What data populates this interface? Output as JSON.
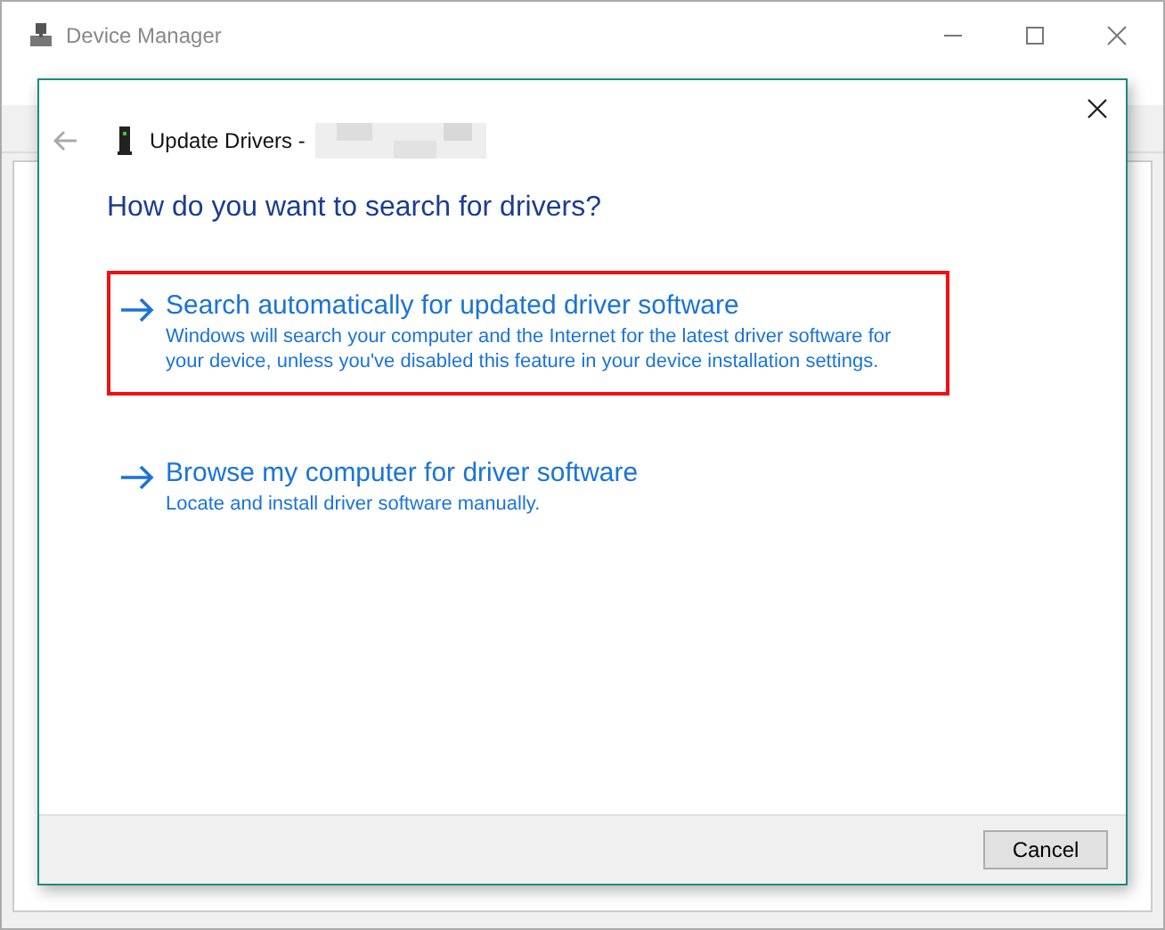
{
  "window": {
    "title": "Device Manager"
  },
  "dialog": {
    "title": "Update Drivers -",
    "heading": "How do you want to search for drivers?",
    "options": [
      {
        "title": "Search automatically for updated driver software",
        "description": "Windows will search your computer and the Internet for the latest driver software for your device, unless you've disabled this feature in your device installation settings.",
        "selected": true
      },
      {
        "title": "Browse my computer for driver software",
        "description": "Locate and install driver software manually.",
        "selected": false
      }
    ],
    "buttons": [
      "Cancel"
    ]
  }
}
